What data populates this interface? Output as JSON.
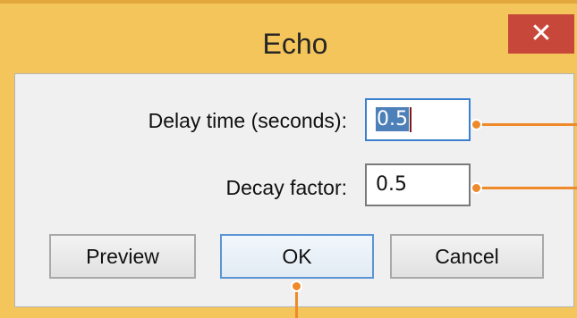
{
  "window": {
    "title": "Echo",
    "close_glyph": "✕"
  },
  "fields": {
    "delay": {
      "label": "Delay time (seconds):",
      "value": "0.5"
    },
    "decay": {
      "label": "Decay factor:",
      "value": "0.5"
    }
  },
  "buttons": {
    "preview": "Preview",
    "ok": "OK",
    "cancel": "Cancel"
  },
  "colors": {
    "titlebar": "#f4c55a",
    "close": "#c7483a",
    "callout": "#ef8a2a",
    "focus": "#3c7fd1"
  }
}
